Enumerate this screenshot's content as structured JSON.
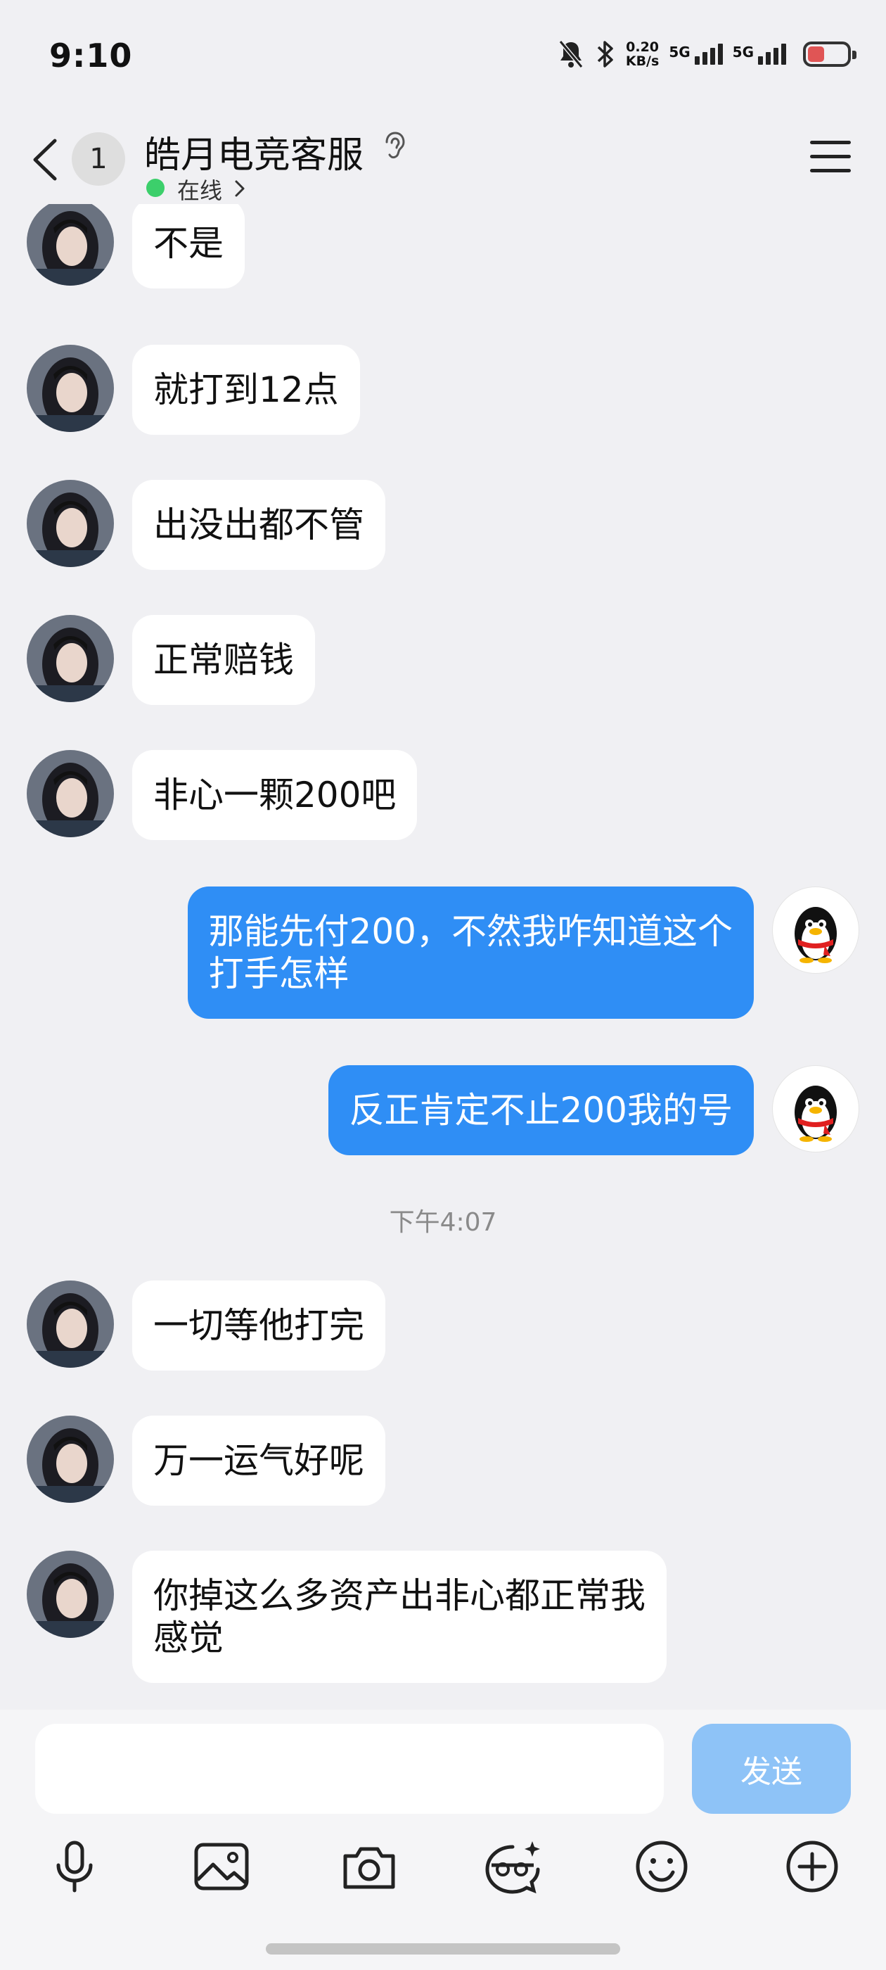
{
  "status_bar": {
    "time": "9:10",
    "net_speed": "0.20",
    "net_unit": "KB/s",
    "sim1_label": "5G",
    "sim2_label": "5G"
  },
  "header": {
    "unread_count": "1",
    "title": "皓月电竞客服",
    "status": "在线"
  },
  "messages": [
    {
      "side": "in",
      "text": "不是"
    },
    {
      "side": "in",
      "text": "就打到12点"
    },
    {
      "side": "in",
      "text": "出没出都不管"
    },
    {
      "side": "in",
      "text": "正常赔钱"
    },
    {
      "side": "in",
      "text": "非心一颗200吧"
    },
    {
      "side": "out",
      "text": "那能先付200，不然我咋知道这个\n打手怎样"
    },
    {
      "side": "out",
      "text": "反正肯定不止200我的号"
    },
    {
      "type": "timestamp",
      "text": "下午4:07"
    },
    {
      "side": "in",
      "text": "一切等他打完"
    },
    {
      "side": "in",
      "text": "万一运气好呢"
    },
    {
      "side": "in",
      "text": "你掉这么多资产出非心都正常我\n感觉"
    }
  ],
  "composer": {
    "input_value": "",
    "input_placeholder": "",
    "send_label": "发送"
  },
  "toolbar": {
    "icons": [
      "microphone-icon",
      "image-icon",
      "camera-icon",
      "sticker-icon",
      "emoji-icon",
      "plus-icon"
    ]
  },
  "colors": {
    "outgoing_bubble": "#2f8ef5",
    "incoming_bubble": "#ffffff",
    "online_dot": "#3ccf6b",
    "send_button": "#8ec3f7"
  }
}
